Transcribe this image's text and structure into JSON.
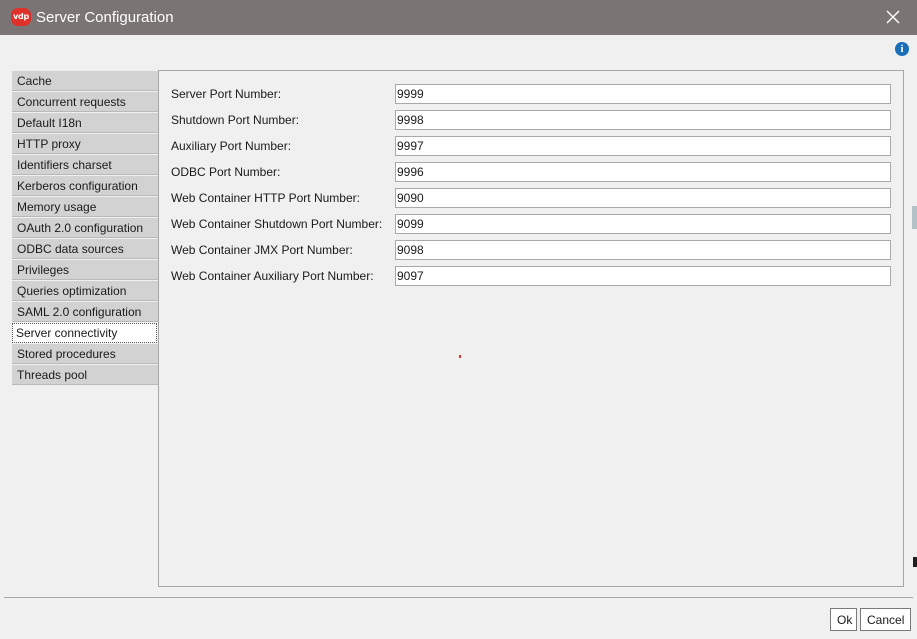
{
  "window": {
    "title": "Server Configuration",
    "logo_text": "vdp",
    "close_icon": "close-icon",
    "info_icon_glyph": "i"
  },
  "sidebar": {
    "items": [
      {
        "label": "Cache",
        "selected": false
      },
      {
        "label": "Concurrent requests",
        "selected": false
      },
      {
        "label": "Default I18n",
        "selected": false
      },
      {
        "label": "HTTP proxy",
        "selected": false
      },
      {
        "label": "Identifiers charset",
        "selected": false
      },
      {
        "label": "Kerberos configuration",
        "selected": false
      },
      {
        "label": "Memory usage",
        "selected": false
      },
      {
        "label": "OAuth 2.0 configuration",
        "selected": false
      },
      {
        "label": "ODBC data sources",
        "selected": false
      },
      {
        "label": "Privileges",
        "selected": false
      },
      {
        "label": "Queries optimization",
        "selected": false
      },
      {
        "label": "SAML 2.0 configuration",
        "selected": false
      },
      {
        "label": "Server connectivity",
        "selected": true
      },
      {
        "label": "Stored procedures",
        "selected": false
      },
      {
        "label": "Threads pool",
        "selected": false
      }
    ]
  },
  "form": {
    "fields": [
      {
        "label": "Server Port Number:",
        "value": "9999"
      },
      {
        "label": "Shutdown Port Number:",
        "value": "9998"
      },
      {
        "label": "Auxiliary Port Number:",
        "value": "9997"
      },
      {
        "label": "ODBC Port Number:",
        "value": "9996"
      },
      {
        "label": "Web Container HTTP Port Number:",
        "value": "9090"
      },
      {
        "label": "Web Container Shutdown Port Number:",
        "value": "9099"
      },
      {
        "label": "Web Container JMX Port Number:",
        "value": "9098"
      },
      {
        "label": "Web Container Auxiliary Port Number:",
        "value": "9097"
      }
    ]
  },
  "buttons": {
    "ok_label": "Ok",
    "cancel_label": "Cancel"
  },
  "colors": {
    "titlebar": "#7b7474",
    "logo": "#e0302a",
    "info": "#1b6fb8",
    "sidebar_item": "#d2d2d2",
    "selected_item": "#ffffff"
  }
}
